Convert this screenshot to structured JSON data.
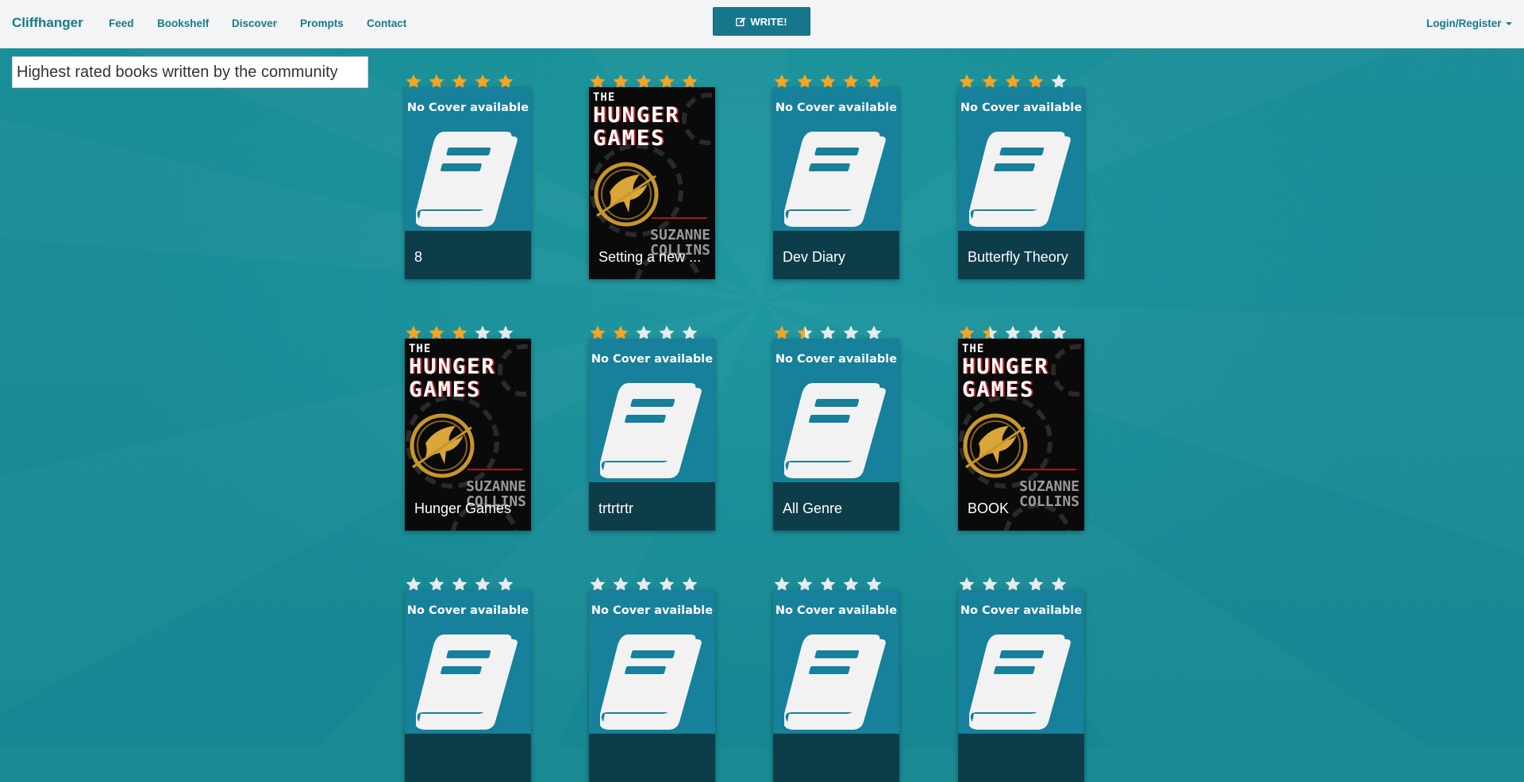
{
  "navbar": {
    "brand": "Cliffhanger",
    "links": [
      "Feed",
      "Bookshelf",
      "Discover",
      "Prompts",
      "Contact"
    ],
    "write_label": "WRITE!",
    "login_label": "Login/Register"
  },
  "heading": "Highest rated books written by the community",
  "colors": {
    "background": "#1a8a94",
    "navbar": "#f3f4f5",
    "brand": "#17798a",
    "star_on": "#f5a623",
    "star_off": "#e8ecef",
    "cover_bg": "#17809a",
    "title_bar": "#0e3d4a"
  },
  "no_cover_text": "No Cover available",
  "hunger_games_cover": {
    "the": "THE",
    "line1": "HUNGER",
    "line2": "GAMES",
    "author1": "SUZANNE",
    "author2": "COLLINS"
  },
  "books": [
    {
      "title": "8",
      "rating": 5,
      "cover": "none"
    },
    {
      "title": "Setting a new ...",
      "rating": 5,
      "cover": "hunger-games"
    },
    {
      "title": "Dev Diary",
      "rating": 5,
      "cover": "none"
    },
    {
      "title": "Butterfly Theory",
      "rating": 4,
      "cover": "none"
    },
    {
      "title": "Hunger Games",
      "rating": 3,
      "cover": "hunger-games"
    },
    {
      "title": "trtrtrtr",
      "rating": 2,
      "cover": "none"
    },
    {
      "title": "All Genre",
      "rating": 1.5,
      "cover": "none"
    },
    {
      "title": "BOOK",
      "rating": 1.5,
      "cover": "hunger-games"
    },
    {
      "title": "",
      "rating": 0,
      "cover": "none"
    },
    {
      "title": "",
      "rating": 0,
      "cover": "none"
    },
    {
      "title": "",
      "rating": 0,
      "cover": "none"
    },
    {
      "title": "",
      "rating": 0,
      "cover": "none"
    }
  ]
}
